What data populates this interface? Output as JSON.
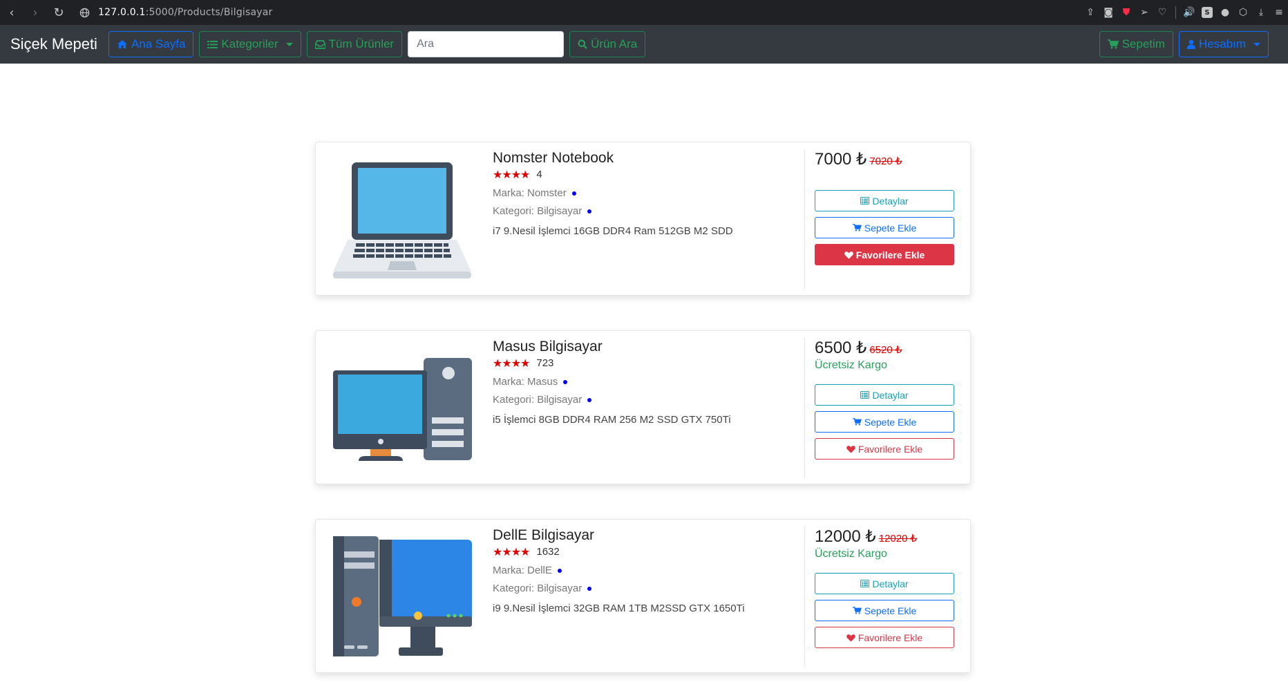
{
  "browser": {
    "url_host": "127.0.0.1",
    "url_path": ":5000/Products/Bilgisayar"
  },
  "navbar": {
    "brand": "Siçek Mepeti",
    "home_label": "Ana Sayfa",
    "categories_label": "Kategoriler",
    "all_products_label": "Tüm Ürünler",
    "search_placeholder": "Ara",
    "search_button_label": "Ürün Ara",
    "cart_label": "Sepetim",
    "account_label": "Hesabım"
  },
  "products": [
    {
      "name": "Nomster Notebook",
      "stars": "★★★★",
      "rating_count": "4",
      "brand": "Marka: Nomster",
      "category": "Kategori: Bilgisayar",
      "description": "i7 9.Nesil İşlemci 16GB DDR4 Ram 512GB M2 SDD",
      "price": "7000 ₺",
      "old_price": "7020 ₺",
      "shipping": "",
      "details_label": "Detaylar",
      "add_cart_label": "Sepete Ekle",
      "favorite_label": "Favorilere Ekle",
      "favorite_active": true,
      "image_icon": "laptop-icon"
    },
    {
      "name": "Masus Bilgisayar",
      "stars": "★★★★",
      "rating_count": "723",
      "brand": "Marka: Masus",
      "category": "Kategori: Bilgisayar",
      "description": "i5 İşlemci 8GB DDR4 RAM 256 M2 SSD GTX 750Ti",
      "price": "6500 ₺",
      "old_price": "6520 ₺",
      "shipping": "Ücretsiz Kargo",
      "details_label": "Detaylar",
      "add_cart_label": "Sepete Ekle",
      "favorite_label": "Favorilere Ekle",
      "favorite_active": false,
      "image_icon": "desktop-pc-icon"
    },
    {
      "name": "DellE Bilgisayar",
      "stars": "★★★★",
      "rating_count": "1632",
      "brand": "Marka: DellE",
      "category": "Kategori: Bilgisayar",
      "description": "i9 9.Nesil İşlemci 32GB RAM 1TB M2SSD GTX 1650Ti",
      "price": "12000 ₺",
      "old_price": "12020 ₺",
      "shipping": "Ücretsiz Kargo",
      "details_label": "Detaylar",
      "add_cart_label": "Sepete Ekle",
      "favorite_label": "Favorilere Ekle",
      "favorite_active": false,
      "image_icon": "tower-pc-icon"
    }
  ],
  "colors": {
    "navbar_bg": "#343a40",
    "primary": "#0d6efd",
    "success": "#198754",
    "danger": "#dc3545",
    "info": "#17a2b8",
    "star": "#e00000"
  }
}
